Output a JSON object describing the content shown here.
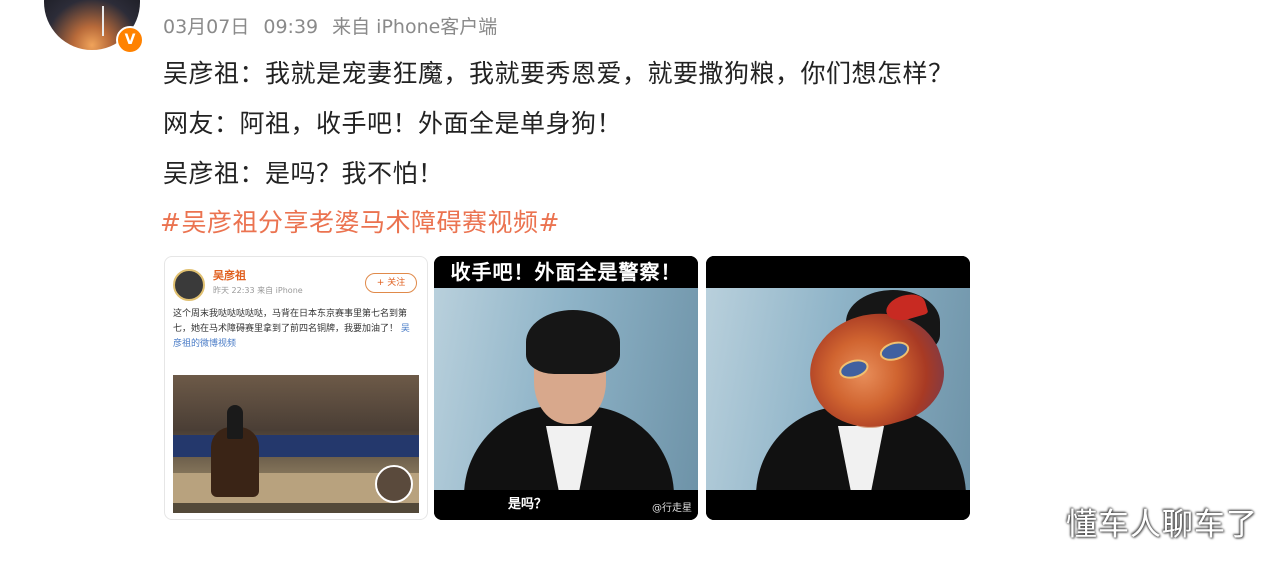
{
  "post": {
    "avatar_icon": "avatar",
    "verified_icon": "verified-badge-icon",
    "verified_glyph": "V",
    "date": "03月07日",
    "time": "09:39",
    "source": "来自 iPhone客户端",
    "lines": [
      "吴彦祖：我就是宠妻狂魔，我就要秀恩爱，就要撒狗粮，你们想怎样？",
      "网友：阿祖，收手吧！外面全是单身狗！",
      "吴彦祖：是吗？我不怕！"
    ],
    "hashtag": "#吴彦祖分享老婆马术障碍赛视频#",
    "accent_color": "#eb7350",
    "meta_color": "#8a8a8a"
  },
  "images": {
    "first": {
      "inner_name": "吴彦祖",
      "inner_meta": "昨天 22:33 来自 iPhone",
      "inner_follow": "+ 关注",
      "inner_text": "这个周末我哒哒哒哒哒，马背在日本东京赛事里第七名到第七，她在马术障碍赛里拿到了前四名铜牌，我要加油了！",
      "inner_link": "吴彦祖的微博视频"
    },
    "second": {
      "caption": "收手吧！外面全是警察！",
      "subtitle": "是吗？",
      "watermark": "@行走星"
    }
  },
  "watermark": "懂车人聊车了"
}
